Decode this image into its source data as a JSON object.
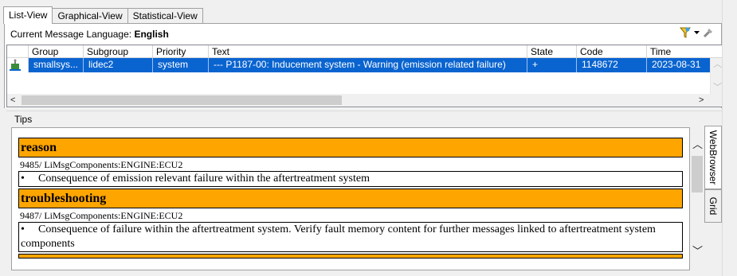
{
  "tabs": [
    "List-View",
    "Graphical-View",
    "Statistical-View"
  ],
  "language": {
    "label": "Current Message Language:",
    "value": "English"
  },
  "table": {
    "columns": [
      "Group",
      "Subgroup",
      "Priority",
      "Text",
      "State",
      "Code",
      "Time"
    ],
    "rows": [
      {
        "group": "smallsys...",
        "subgroup": "lidec2",
        "priority": "system",
        "text": "---  P1187-00: Inducement system - Warning (emission related failure)",
        "state": "+",
        "code": "1148672",
        "time": "2023-08-31"
      }
    ]
  },
  "tips": {
    "label": "Tips",
    "sections": [
      {
        "heading": "reason",
        "path": "9485/ LiMsgComponents:ENGINE:ECU2",
        "bullet": "•",
        "text": "Consequence of emission relevant failure within the aftertreatment system"
      },
      {
        "heading": "troubleshooting",
        "path": "9487/ LiMsgComponents:ENGINE:ECU2",
        "bullet": "•",
        "text": "Consequence of failure within the aftertreatment system. Verify fault memory content for further messages linked to aftertreatment system components"
      }
    ]
  },
  "side_tabs": [
    "WebBrowser",
    "Grid"
  ],
  "colors": {
    "selection": "#0a64d0",
    "section_header": "#ffa500"
  }
}
